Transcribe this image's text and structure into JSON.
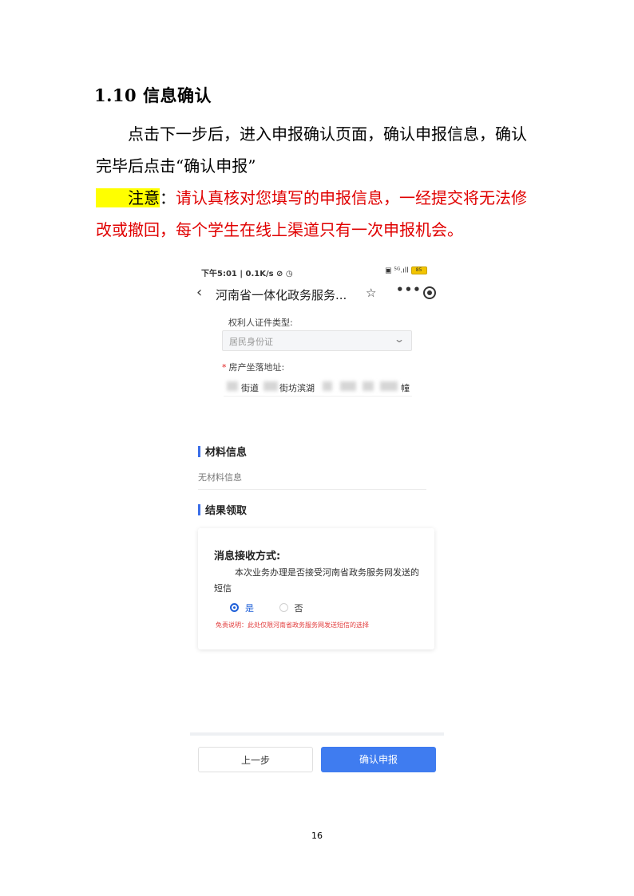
{
  "doc": {
    "heading": "1.10 信息确认",
    "paragraph": "点击下一步后，进入申报确认页面，确认申报信息，确认完毕后点击“确认申报”",
    "note_label": "注意",
    "note_colon": "：",
    "note_text": "请认真核对您填写的申报信息，一经提交将无法修改或撤回，每个学生在线上渠道只有一次申报机会。",
    "page_number": "16"
  },
  "phone": {
    "status_left": "下午5:01 | 0.1K/s",
    "status_icons": "⊘ ◷",
    "status_right": "▣ ⁵ᴳ.ıll",
    "battery": "85",
    "nav": {
      "back_icon": "‹",
      "title": "河南省一体化政务服务...",
      "star_icon": "☆",
      "more_icon": "•••"
    },
    "form": {
      "id_type_label": "权利人证件类型:",
      "id_type_value": "居民身份证",
      "address_required": "*",
      "address_label": "房产坐落地址:",
      "address_value_1": "街道",
      "address_value_2": "街坊滨湖",
      "address_value_3": "幢"
    },
    "materials": {
      "title": "材料信息",
      "empty": "无材料信息"
    },
    "result": {
      "title": "结果领取",
      "card_title": "消息接收方式:",
      "card_desc": "本次业务办理是否接受河南省政务服务网发送的短信",
      "option_yes": "是",
      "option_no": "否",
      "disclaimer": "免责说明：此处仅限河南省政务服务网发送短信的选择"
    },
    "buttons": {
      "prev": "上一步",
      "confirm": "确认申报"
    }
  }
}
